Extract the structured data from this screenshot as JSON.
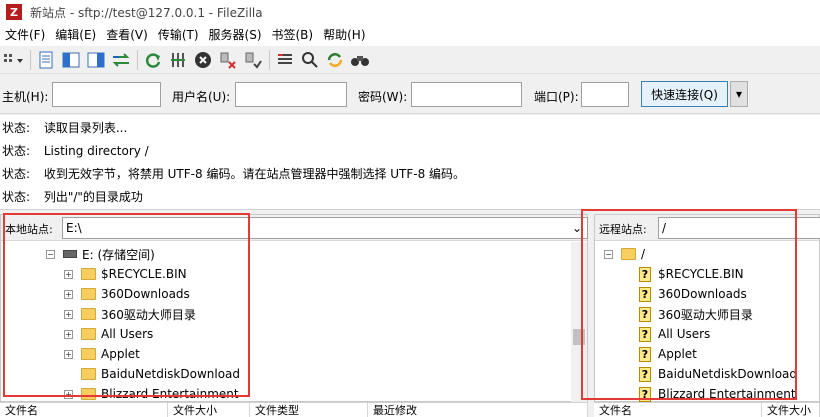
{
  "window": {
    "title": "新站点 - sftp://test@127.0.0.1 - FileZilla",
    "app_icon_letter": "Z"
  },
  "menu": [
    {
      "label": "文件(F)"
    },
    {
      "label": "编辑(E)"
    },
    {
      "label": "查看(V)"
    },
    {
      "label": "传输(T)"
    },
    {
      "label": "服务器(S)"
    },
    {
      "label": "书签(B)"
    },
    {
      "label": "帮助(H)"
    }
  ],
  "toolbar": [
    {
      "icon": "site-manager-icon"
    },
    {
      "icon": "toggle-log-icon"
    },
    {
      "icon": "toggle-local-tree-icon"
    },
    {
      "icon": "toggle-remote-tree-icon"
    },
    {
      "icon": "toggle-queue-icon"
    },
    {
      "icon": "refresh-icon"
    },
    {
      "icon": "process-queue-icon"
    },
    {
      "icon": "cancel-icon"
    },
    {
      "icon": "disconnect-icon"
    },
    {
      "icon": "reconnect-icon"
    },
    {
      "icon": "directory-filter-icon"
    },
    {
      "icon": "search-icon"
    },
    {
      "icon": "sync-browsing-icon"
    },
    {
      "icon": "find-files-icon"
    }
  ],
  "quickconnect": {
    "host_label": "主机(H):",
    "user_label": "用户名(U):",
    "password_label": "密码(W):",
    "port_label": "端口(P):",
    "host_value": "",
    "user_value": "",
    "password_value": "",
    "port_value": "",
    "connect_label": "快速连接(Q)",
    "dropdown_arrow": "▾"
  },
  "log": [
    {
      "label": "状态:",
      "text": "读取目录列表..."
    },
    {
      "label": "状态:",
      "text": "Listing directory /"
    },
    {
      "label": "状态:",
      "text": "收到无效字节，将禁用 UTF-8 编码。请在站点管理器中强制选择 UTF-8 编码。"
    },
    {
      "label": "状态:",
      "text": "列出\"/\"的目录成功"
    }
  ],
  "local": {
    "label": "本地站点:",
    "path": "E:\\",
    "path_dropdown_arrow": "⌄",
    "expander_collapsed": "+",
    "expander_expanded": "−",
    "drive": "E: (存储空间)",
    "items": [
      {
        "name": "$RECYCLE.BIN"
      },
      {
        "name": "360Downloads"
      },
      {
        "name": "360驱动大师目录"
      },
      {
        "name": "All Users"
      },
      {
        "name": "Applet"
      },
      {
        "name": "BaiduNetdiskDownload"
      },
      {
        "name": "Blizzard Entertainment"
      }
    ],
    "columns": [
      "文件名",
      "文件大小",
      "文件类型",
      "最近修改"
    ]
  },
  "remote": {
    "label": "远程站点:",
    "path": "/",
    "root": "/",
    "unknown_icon_glyph": "?",
    "items": [
      {
        "name": "$RECYCLE.BIN"
      },
      {
        "name": "360Downloads"
      },
      {
        "name": "360驱动大师目录"
      },
      {
        "name": "All Users"
      },
      {
        "name": "Applet"
      },
      {
        "name": "BaiduNetdiskDownload"
      },
      {
        "name": "Blizzard Entertainment"
      }
    ],
    "columns": [
      "文件名",
      "文件大小"
    ]
  },
  "highlight_color": "#e53935"
}
